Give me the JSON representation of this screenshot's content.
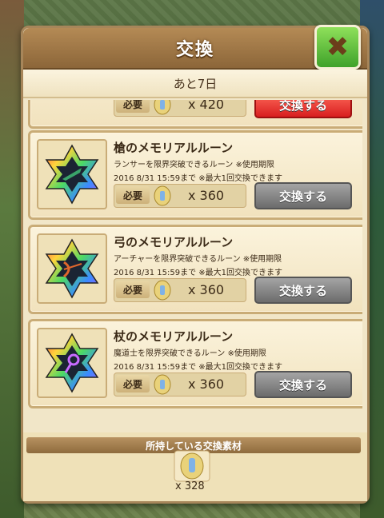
{
  "dialog": {
    "title": "交換",
    "remaining": "あと7日",
    "close_icon": "close-x-icon"
  },
  "partial_item": {
    "qty": "x 420",
    "button": "交換する"
  },
  "items": [
    {
      "name": "槍のメモリアルルーン",
      "desc": "ランサーを限界突破できるルーン ※使用期限",
      "deadline": "2016  8/31  15:59まで ※最大1回交換できます",
      "req_label": "必要",
      "qty": "x 360",
      "button": "交換する",
      "icon": "lancer-rune-icon",
      "accent": "#1d6a3a"
    },
    {
      "name": "弓のメモリアルルーン",
      "desc": "アーチャーを限界突破できるルーン ※使用期限",
      "deadline": "2016  8/31  15:59まで ※最大1回交換できます",
      "req_label": "必要",
      "qty": "x 360",
      "button": "交換する",
      "icon": "archer-rune-icon",
      "accent": "#c0392b"
    },
    {
      "name": "杖のメモリアルルーン",
      "desc": "魔道士を限界突破できるルーン ※使用期限",
      "deadline": "2016  8/31  15:59まで ※最大1回交換できます",
      "req_label": "必要",
      "qty": "x 360",
      "button": "交換する",
      "icon": "caster-rune-icon",
      "accent": "#8e44ad"
    }
  ],
  "owned": {
    "title": "所持している交換素材",
    "qty": "x 328",
    "icon": "exchange-material-icon"
  }
}
